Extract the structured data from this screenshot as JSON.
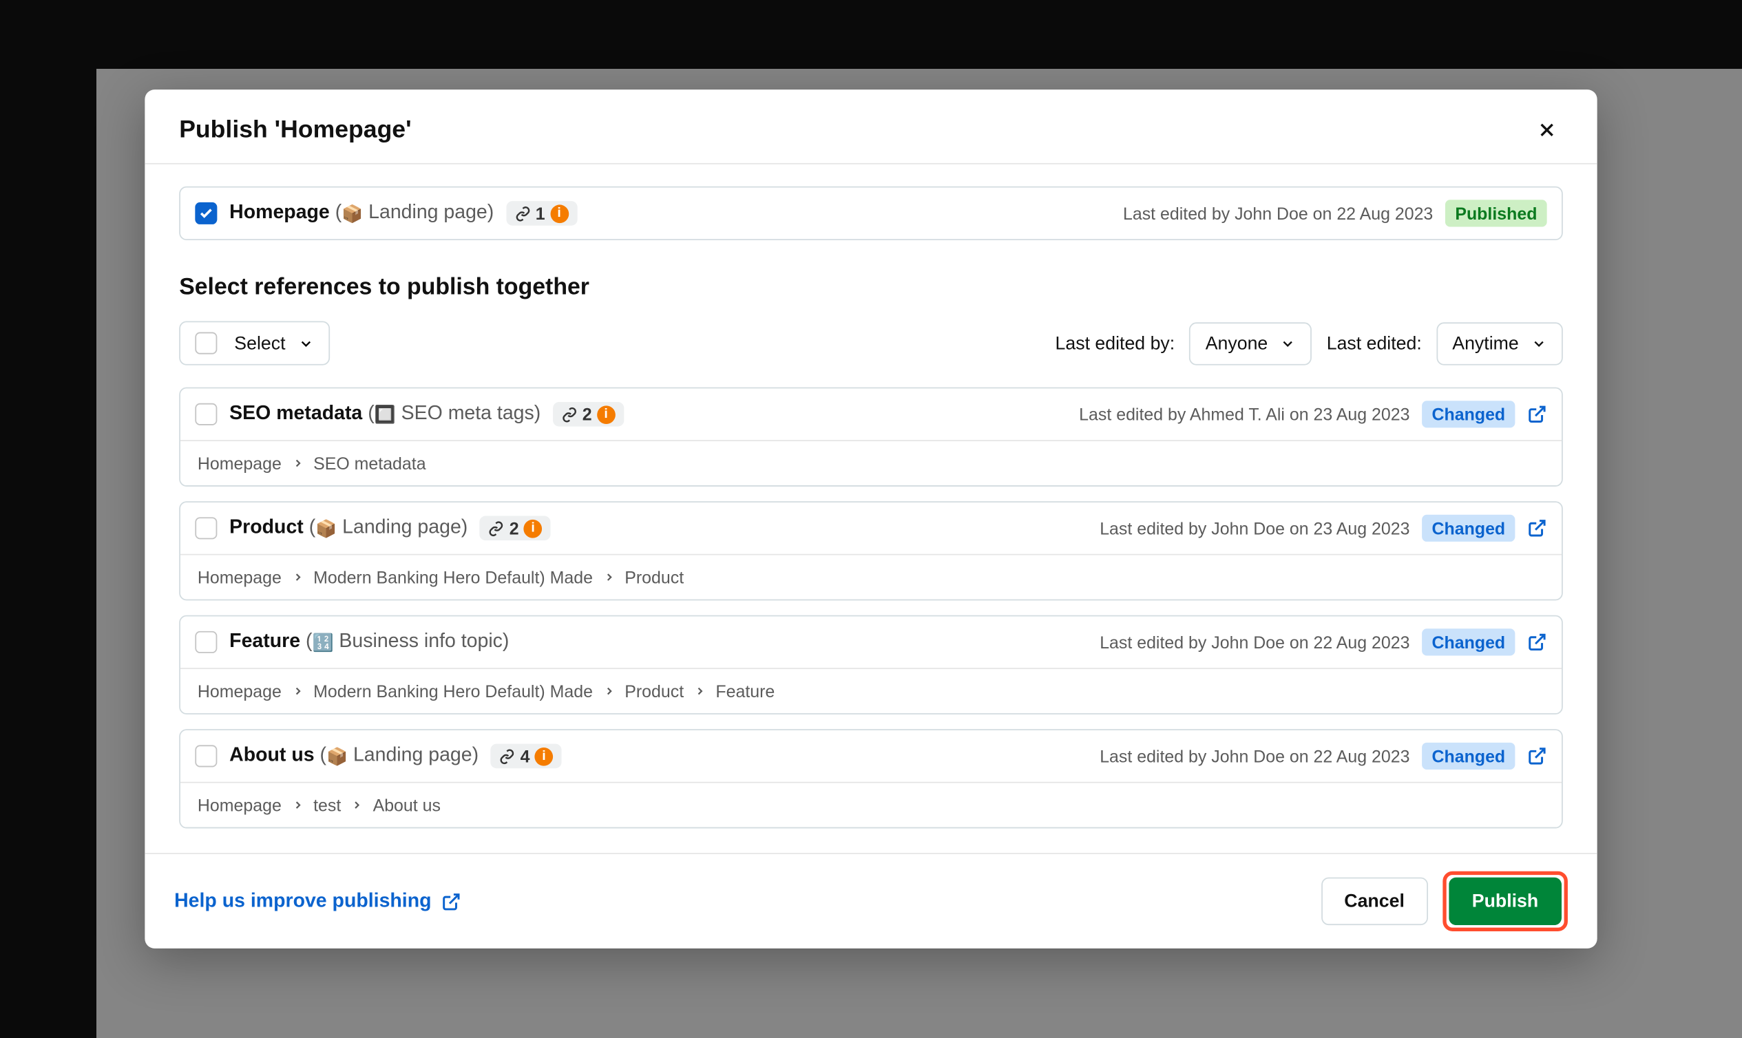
{
  "modal": {
    "title": "Publish 'Homepage'",
    "main_entry": {
      "name": "Homepage",
      "type_icon": "📦",
      "type_label": "Landing page",
      "link_count": "1",
      "last_edited": "Last edited by John Doe on 22 Aug 2023",
      "status": "Published"
    },
    "section_title": "Select references to publish together",
    "filters": {
      "select_label": "Select",
      "edited_by_label": "Last edited by:",
      "edited_by_value": "Anyone",
      "edited_when_label": "Last edited:",
      "edited_when_value": "Anytime"
    },
    "references": [
      {
        "name": "SEO metadata",
        "type_icon": "🔲",
        "type_label": "SEO meta tags",
        "link_count": "2",
        "last_edited": "Last edited by Ahmed T. Ali on 23 Aug 2023",
        "status": "Changed",
        "breadcrumb": [
          "Homepage",
          "SEO metadata"
        ]
      },
      {
        "name": "Product",
        "type_icon": "📦",
        "type_label": "Landing page",
        "link_count": "2",
        "last_edited": "Last edited by John Doe on 23 Aug 2023",
        "status": "Changed",
        "breadcrumb": [
          "Homepage",
          "Modern Banking Hero Default) Made",
          "Product"
        ]
      },
      {
        "name": "Feature",
        "type_icon": "🔢",
        "type_label": "Business info topic",
        "link_count": "",
        "last_edited": "Last edited by John Doe on 22 Aug 2023",
        "status": "Changed",
        "breadcrumb": [
          "Homepage",
          "Modern Banking Hero Default) Made",
          "Product",
          "Feature"
        ]
      },
      {
        "name": "About us",
        "type_icon": "📦",
        "type_label": "Landing page",
        "link_count": "4",
        "last_edited": "Last edited by John Doe on 22 Aug 2023",
        "status": "Changed",
        "breadcrumb": [
          "Homepage",
          "test",
          "About us"
        ]
      }
    ],
    "footer": {
      "help_link": "Help us improve publishing",
      "cancel": "Cancel",
      "publish": "Publish"
    }
  }
}
